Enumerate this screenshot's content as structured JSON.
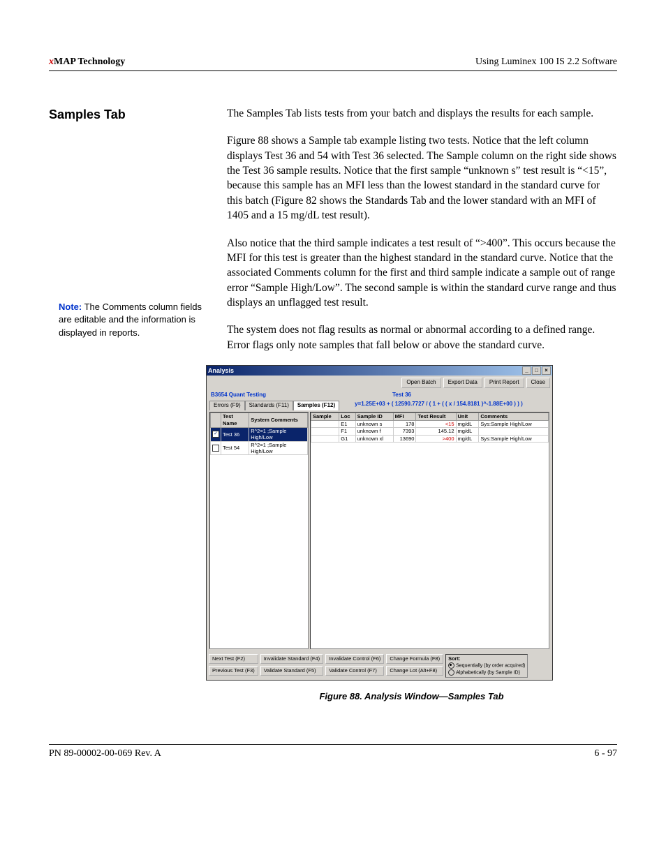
{
  "header": {
    "left_x": "x",
    "left_rest": "MAP Technology",
    "right": "Using Luminex 100 IS 2.2 Software"
  },
  "section_title": "Samples Tab",
  "note": {
    "label": "Note:",
    "text": "The Comments column fields are editable and the information is displayed in reports."
  },
  "paras": {
    "p1": "The Samples Tab lists tests from your batch and displays the results for each sample.",
    "p2": "Figure 88 shows a Sample tab example listing two tests. Notice that the left column displays Test 36 and 54 with Test 36 selected. The Sample column on the right side shows the Test 36 sample results. Notice that the first sample “unknown s” test result is “<15”, because this sample has an MFI less than the lowest standard in the standard curve for this batch (Figure 82 shows the Standards Tab and the lower standard with an MFI of 1405 and a 15 mg/dL test result).",
    "p3": "Also notice that the third sample indicates a test result of “>400”. This occurs because the MFI for this test is greater than the highest standard in the standard curve. Notice that the associated Comments column for the first and third sample indicate a sample out of range error “Sample High/Low”. The second sample is within the standard curve range and thus displays an unflagged test result.",
    "p4": "The system does not flag results as normal or abnormal according to a defined range. Error flags only note samples that fall below or above the standard curve."
  },
  "fig": {
    "caption": "Figure 88.  Analysis Window—Samples Tab",
    "title": "Analysis",
    "topbtns": [
      "Open Batch",
      "Export Data",
      "Print Report",
      "Close"
    ],
    "batch_title": "B3654 Quant Testing",
    "test_label": "Test 36",
    "tabs": [
      "Errors (F9)",
      "Standards (F11)",
      "Samples (F12)"
    ],
    "formula": "y=1.25E+03 + ( 12590.7727 / ( 1 + ( ( x / 154.8181 )^-1.88E+00 ) ) )",
    "left_headers": [
      "",
      "Test Name",
      "System Comments"
    ],
    "left_rows": [
      {
        "selected": true,
        "checked": true,
        "name": "Test 36",
        "comment": "R^2=1 ;Sample High/Low"
      },
      {
        "selected": false,
        "checked": false,
        "name": "Test 54",
        "comment": "R^2=1 ;Sample High/Low"
      }
    ],
    "right_headers": [
      "Sample",
      "Loc",
      "Sample ID",
      "MFI",
      "Test Result",
      "Unit",
      "Comments"
    ],
    "right_rows": [
      {
        "sample": "",
        "loc": "E1",
        "id": "unknown s",
        "mfi": "178",
        "result": "<15",
        "result_red": true,
        "unit": "mg/dL",
        "comments": "Sys:Sample High/Low"
      },
      {
        "sample": "",
        "loc": "F1",
        "id": "unknown f",
        "mfi": "7393",
        "result": "145.12",
        "result_red": false,
        "unit": "mg/dL",
        "comments": ""
      },
      {
        "sample": "",
        "loc": "G1",
        "id": "unknown xl",
        "mfi": "13690",
        "result": ">400",
        "result_red": true,
        "unit": "mg/dL",
        "comments": "Sys:Sample High/Low"
      }
    ],
    "bottom": {
      "c1": [
        "Next Test (F2)",
        "Previous Test (F3)"
      ],
      "c2": [
        "Invalidate Standard (F4)",
        "Validate Standard (F5)"
      ],
      "c3": [
        "Invalidate Control (F6)",
        "Validate Control (F7)"
      ],
      "c4": [
        "Change Formula (F8)",
        "Change Lot (Alt+F8)"
      ],
      "sort_title": "Sort:",
      "sort1": "Sequentially (by order acquired)",
      "sort2": "Alphabetically (by Sample ID)"
    }
  },
  "footer": {
    "left": "PN 89-00002-00-069 Rev. A",
    "right": "6 - 97"
  }
}
